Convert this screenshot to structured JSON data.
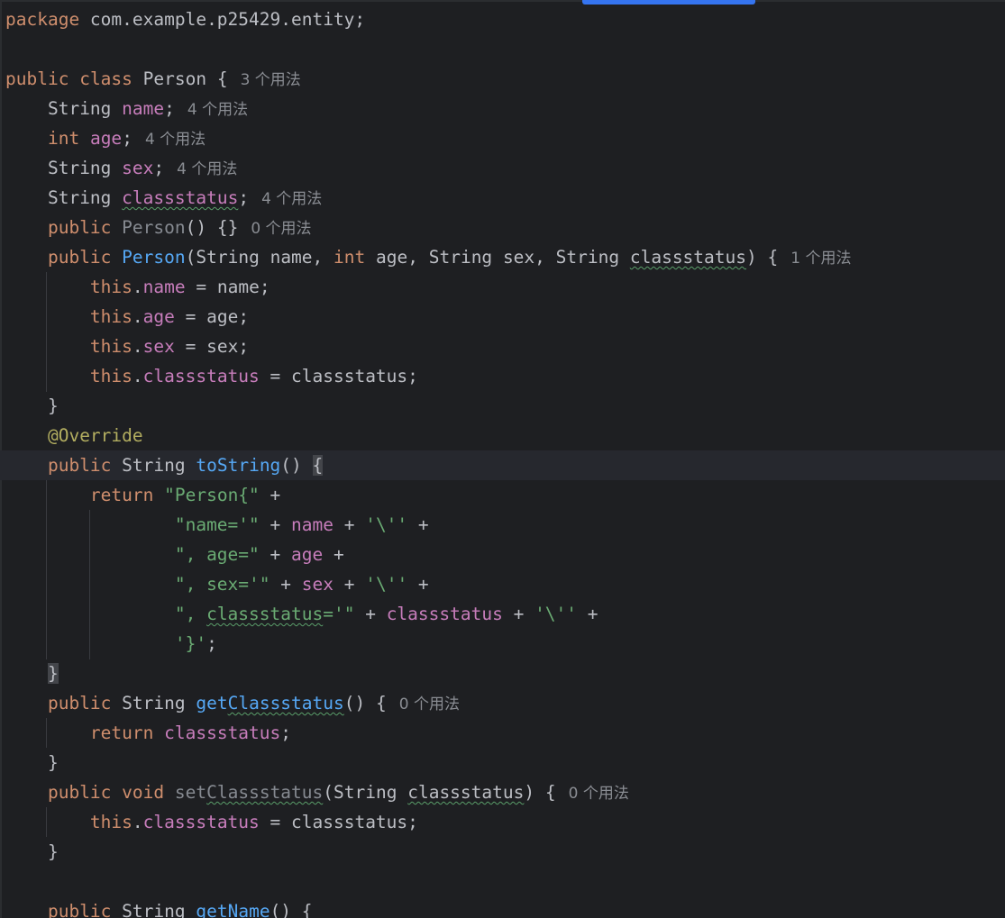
{
  "hints": {
    "u3": "3 个用法",
    "u4": "4 个用法",
    "u0": "0 个用法",
    "u1": "1 个用法"
  },
  "code": {
    "pkg_kw": "package",
    "pkg_name": " com.example.p25429.entity;",
    "cls_public": "public",
    "cls_class": "class",
    "cls_name": " Person {",
    "t_string": "String",
    "t_int": "int",
    "f_name": "name",
    "f_age": "age",
    "f_sex": "sex",
    "f_classstatus": "classstatus",
    "this": "this",
    "ret": "return",
    "void": "void",
    "annotation": "@Override",
    "ctor_name": "Person",
    "m_tostring": "toString",
    "m_getclassstatus_get": "get",
    "m_setclassstatus_set": "set",
    "m_classstatus_suffix": "Classstatus",
    "m_getname": "getName",
    "s_person_open": "\"Person{\"",
    "s_name_eq": "\"name='\"",
    "s_age_eq": "\", age=\"",
    "s_sex_eq": "\", sex='\"",
    "s_cs_prefix": "\", ",
    "s_cs_word": "classstatus",
    "s_cs_suffix": "='\"",
    "s_quote_char": "'\\''",
    "s_close": "'}'"
  }
}
